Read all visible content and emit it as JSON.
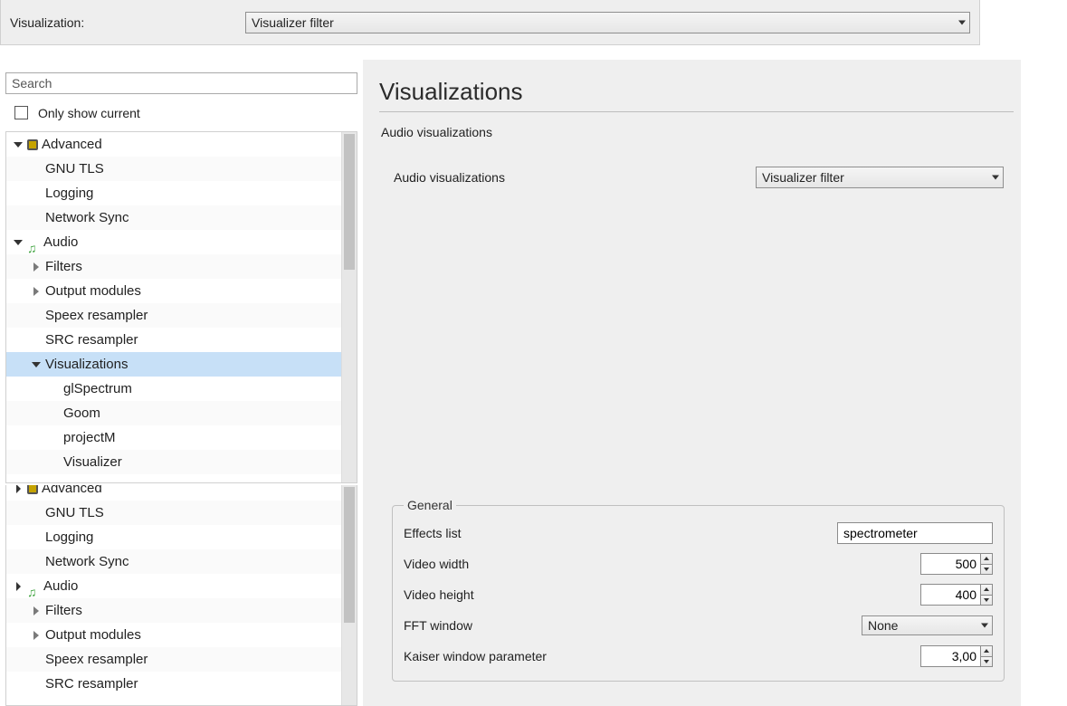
{
  "top": {
    "label": "Visualization:",
    "combo_value": "Visualizer filter"
  },
  "search": {
    "placeholder": "Search"
  },
  "only_show_current_label": "Only show current",
  "tree1": [
    {
      "indent": 0,
      "caret": "down",
      "icon": "chip",
      "label": "Advanced"
    },
    {
      "indent": 1,
      "caret": "none",
      "icon": "",
      "label": "GNU TLS"
    },
    {
      "indent": 1,
      "caret": "none",
      "icon": "",
      "label": "Logging"
    },
    {
      "indent": 1,
      "caret": "none",
      "icon": "",
      "label": "Network Sync"
    },
    {
      "indent": 0,
      "caret": "down",
      "icon": "note",
      "label": "Audio"
    },
    {
      "indent": 1,
      "caret": "right",
      "icon": "",
      "label": "Filters"
    },
    {
      "indent": 1,
      "caret": "right",
      "icon": "",
      "label": "Output modules"
    },
    {
      "indent": 1,
      "caret": "none",
      "icon": "",
      "label": "Speex resampler"
    },
    {
      "indent": 1,
      "caret": "none",
      "icon": "",
      "label": "SRC resampler"
    },
    {
      "indent": 1,
      "caret": "down",
      "icon": "",
      "label": "Visualizations",
      "selected": true
    },
    {
      "indent": 2,
      "caret": "none",
      "icon": "",
      "label": "glSpectrum"
    },
    {
      "indent": 2,
      "caret": "none",
      "icon": "",
      "label": "Goom"
    },
    {
      "indent": 2,
      "caret": "none",
      "icon": "",
      "label": "projectM"
    },
    {
      "indent": 2,
      "caret": "none",
      "icon": "",
      "label": "Visualizer"
    }
  ],
  "tree2": [
    {
      "indent": 0,
      "caret": "half",
      "icon": "chip",
      "label": "Advanced",
      "cut": true
    },
    {
      "indent": 1,
      "caret": "none",
      "icon": "",
      "label": "GNU TLS"
    },
    {
      "indent": 1,
      "caret": "none",
      "icon": "",
      "label": "Logging"
    },
    {
      "indent": 1,
      "caret": "none",
      "icon": "",
      "label": "Network Sync"
    },
    {
      "indent": 0,
      "caret": "half",
      "icon": "note",
      "label": "Audio"
    },
    {
      "indent": 1,
      "caret": "right",
      "icon": "",
      "label": "Filters"
    },
    {
      "indent": 1,
      "caret": "right",
      "icon": "",
      "label": "Output modules"
    },
    {
      "indent": 1,
      "caret": "none",
      "icon": "",
      "label": "Speex resampler"
    },
    {
      "indent": 1,
      "caret": "none",
      "icon": "",
      "label": "SRC resampler"
    }
  ],
  "panel": {
    "heading": "Visualizations",
    "subhead": "Audio visualizations",
    "row_label": "Audio visualizations",
    "combo_value": "Visualizer filter"
  },
  "general": {
    "legend": "General",
    "effects_list_label": "Effects list",
    "effects_list_value": "spectrometer",
    "video_width_label": "Video width",
    "video_width_value": "500",
    "video_height_label": "Video height",
    "video_height_value": "400",
    "fft_window_label": "FFT window",
    "fft_window_value": "None",
    "kaiser_label": "Kaiser window parameter",
    "kaiser_value": "3,00"
  }
}
